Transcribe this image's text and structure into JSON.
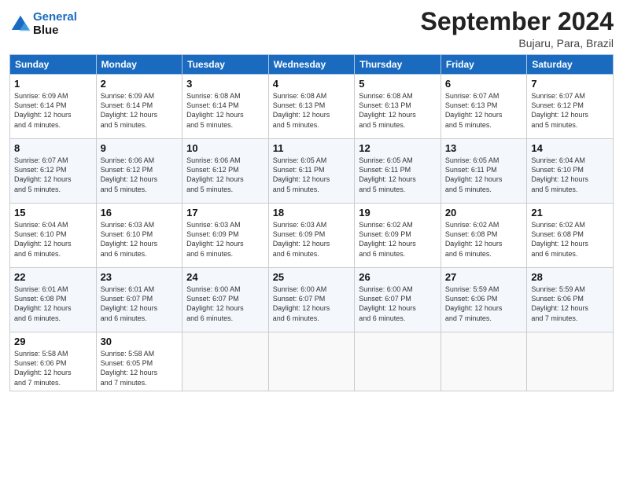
{
  "header": {
    "logo_line1": "General",
    "logo_line2": "Blue",
    "month": "September 2024",
    "location": "Bujaru, Para, Brazil"
  },
  "weekdays": [
    "Sunday",
    "Monday",
    "Tuesday",
    "Wednesday",
    "Thursday",
    "Friday",
    "Saturday"
  ],
  "weeks": [
    [
      {
        "day": "1",
        "info": "Sunrise: 6:09 AM\nSunset: 6:14 PM\nDaylight: 12 hours\nand 4 minutes."
      },
      {
        "day": "2",
        "info": "Sunrise: 6:09 AM\nSunset: 6:14 PM\nDaylight: 12 hours\nand 5 minutes."
      },
      {
        "day": "3",
        "info": "Sunrise: 6:08 AM\nSunset: 6:14 PM\nDaylight: 12 hours\nand 5 minutes."
      },
      {
        "day": "4",
        "info": "Sunrise: 6:08 AM\nSunset: 6:13 PM\nDaylight: 12 hours\nand 5 minutes."
      },
      {
        "day": "5",
        "info": "Sunrise: 6:08 AM\nSunset: 6:13 PM\nDaylight: 12 hours\nand 5 minutes."
      },
      {
        "day": "6",
        "info": "Sunrise: 6:07 AM\nSunset: 6:13 PM\nDaylight: 12 hours\nand 5 minutes."
      },
      {
        "day": "7",
        "info": "Sunrise: 6:07 AM\nSunset: 6:12 PM\nDaylight: 12 hours\nand 5 minutes."
      }
    ],
    [
      {
        "day": "8",
        "info": "Sunrise: 6:07 AM\nSunset: 6:12 PM\nDaylight: 12 hours\nand 5 minutes."
      },
      {
        "day": "9",
        "info": "Sunrise: 6:06 AM\nSunset: 6:12 PM\nDaylight: 12 hours\nand 5 minutes."
      },
      {
        "day": "10",
        "info": "Sunrise: 6:06 AM\nSunset: 6:12 PM\nDaylight: 12 hours\nand 5 minutes."
      },
      {
        "day": "11",
        "info": "Sunrise: 6:05 AM\nSunset: 6:11 PM\nDaylight: 12 hours\nand 5 minutes."
      },
      {
        "day": "12",
        "info": "Sunrise: 6:05 AM\nSunset: 6:11 PM\nDaylight: 12 hours\nand 5 minutes."
      },
      {
        "day": "13",
        "info": "Sunrise: 6:05 AM\nSunset: 6:11 PM\nDaylight: 12 hours\nand 5 minutes."
      },
      {
        "day": "14",
        "info": "Sunrise: 6:04 AM\nSunset: 6:10 PM\nDaylight: 12 hours\nand 5 minutes."
      }
    ],
    [
      {
        "day": "15",
        "info": "Sunrise: 6:04 AM\nSunset: 6:10 PM\nDaylight: 12 hours\nand 6 minutes."
      },
      {
        "day": "16",
        "info": "Sunrise: 6:03 AM\nSunset: 6:10 PM\nDaylight: 12 hours\nand 6 minutes."
      },
      {
        "day": "17",
        "info": "Sunrise: 6:03 AM\nSunset: 6:09 PM\nDaylight: 12 hours\nand 6 minutes."
      },
      {
        "day": "18",
        "info": "Sunrise: 6:03 AM\nSunset: 6:09 PM\nDaylight: 12 hours\nand 6 minutes."
      },
      {
        "day": "19",
        "info": "Sunrise: 6:02 AM\nSunset: 6:09 PM\nDaylight: 12 hours\nand 6 minutes."
      },
      {
        "day": "20",
        "info": "Sunrise: 6:02 AM\nSunset: 6:08 PM\nDaylight: 12 hours\nand 6 minutes."
      },
      {
        "day": "21",
        "info": "Sunrise: 6:02 AM\nSunset: 6:08 PM\nDaylight: 12 hours\nand 6 minutes."
      }
    ],
    [
      {
        "day": "22",
        "info": "Sunrise: 6:01 AM\nSunset: 6:08 PM\nDaylight: 12 hours\nand 6 minutes."
      },
      {
        "day": "23",
        "info": "Sunrise: 6:01 AM\nSunset: 6:07 PM\nDaylight: 12 hours\nand 6 minutes."
      },
      {
        "day": "24",
        "info": "Sunrise: 6:00 AM\nSunset: 6:07 PM\nDaylight: 12 hours\nand 6 minutes."
      },
      {
        "day": "25",
        "info": "Sunrise: 6:00 AM\nSunset: 6:07 PM\nDaylight: 12 hours\nand 6 minutes."
      },
      {
        "day": "26",
        "info": "Sunrise: 6:00 AM\nSunset: 6:07 PM\nDaylight: 12 hours\nand 6 minutes."
      },
      {
        "day": "27",
        "info": "Sunrise: 5:59 AM\nSunset: 6:06 PM\nDaylight: 12 hours\nand 7 minutes."
      },
      {
        "day": "28",
        "info": "Sunrise: 5:59 AM\nSunset: 6:06 PM\nDaylight: 12 hours\nand 7 minutes."
      }
    ],
    [
      {
        "day": "29",
        "info": "Sunrise: 5:58 AM\nSunset: 6:06 PM\nDaylight: 12 hours\nand 7 minutes."
      },
      {
        "day": "30",
        "info": "Sunrise: 5:58 AM\nSunset: 6:05 PM\nDaylight: 12 hours\nand 7 minutes."
      },
      {
        "day": "",
        "info": ""
      },
      {
        "day": "",
        "info": ""
      },
      {
        "day": "",
        "info": ""
      },
      {
        "day": "",
        "info": ""
      },
      {
        "day": "",
        "info": ""
      }
    ]
  ]
}
